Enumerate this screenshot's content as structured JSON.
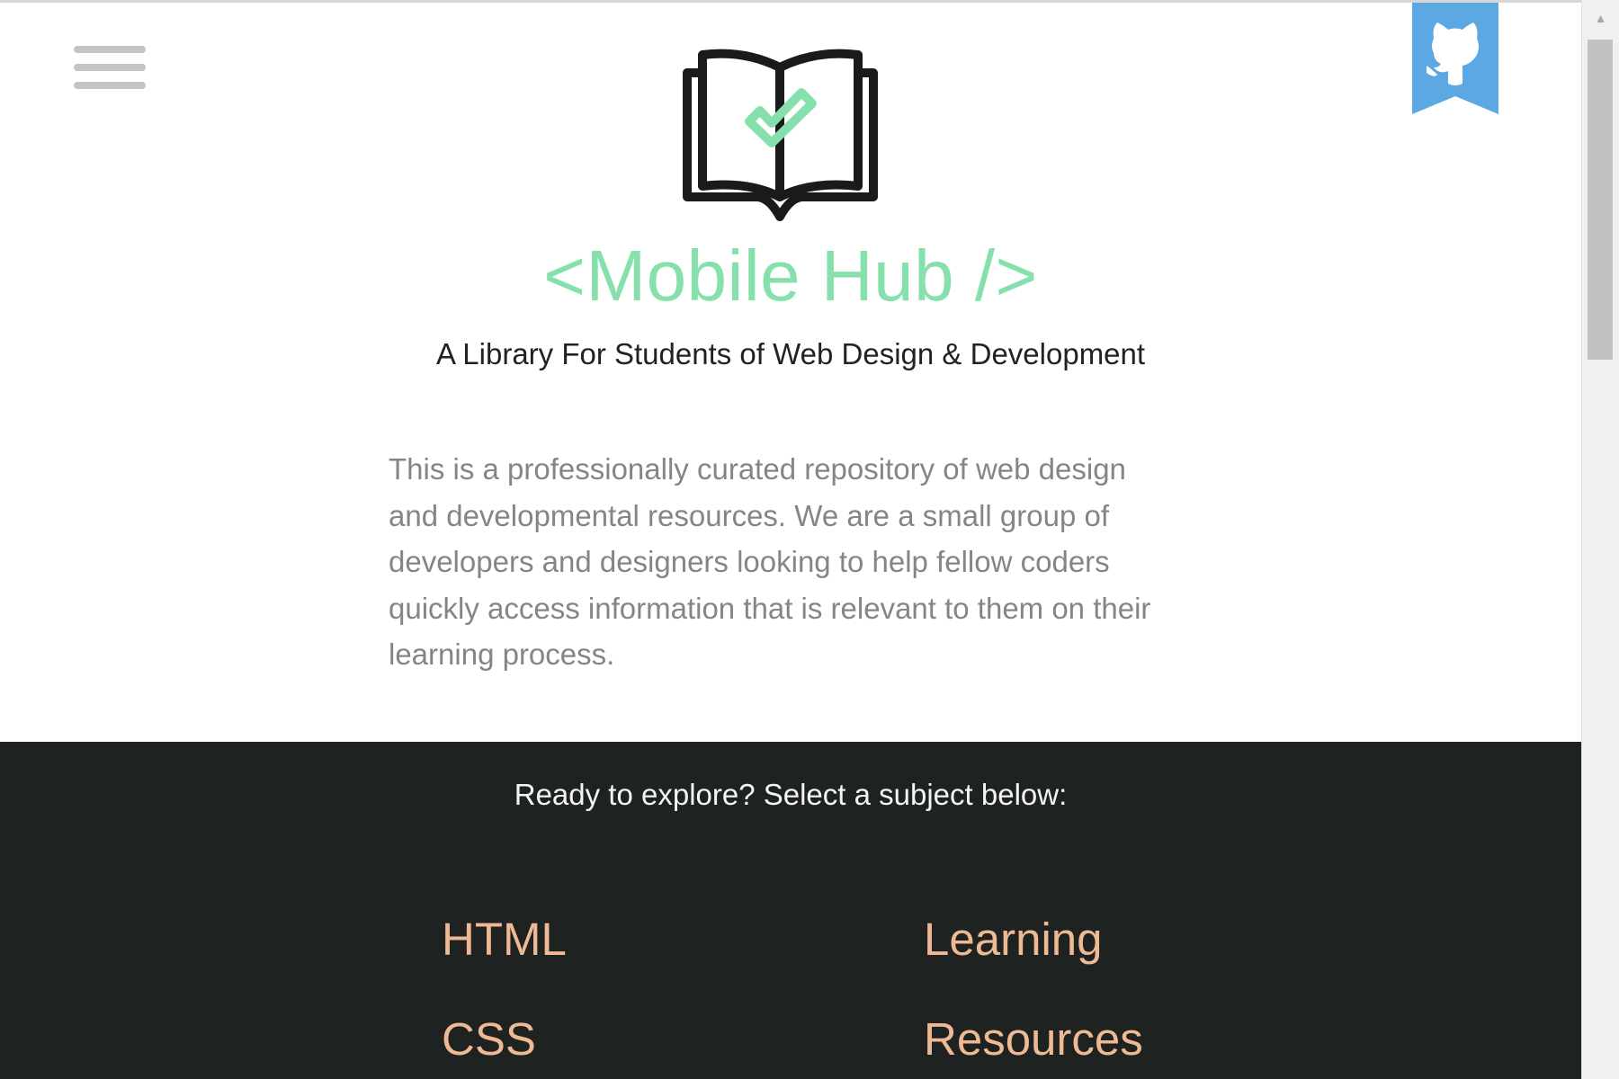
{
  "header": {
    "menu_icon": "hamburger-menu-icon",
    "github_icon": "github-octocat-icon",
    "logo_icon": "open-book-checkmark-icon"
  },
  "hero": {
    "brand": "<Mobile Hub />",
    "tagline": "A Library For Students of Web Design & Development",
    "intro": "This is a professionally curated repository of web design and developmental resources. We are a small group of developers and designers looking to help fellow coders quickly access information that is relevant to them on their learning process."
  },
  "explore": {
    "prompt": "Ready to explore? Select a subject below:",
    "subjects": [
      "HTML",
      "Learning",
      "CSS",
      "Resources"
    ]
  },
  "colors": {
    "brand_green": "#86e0ac",
    "subject_orange": "#efb993",
    "dark_bg": "#1e2221",
    "ribbon_blue": "#5ba8e3"
  }
}
